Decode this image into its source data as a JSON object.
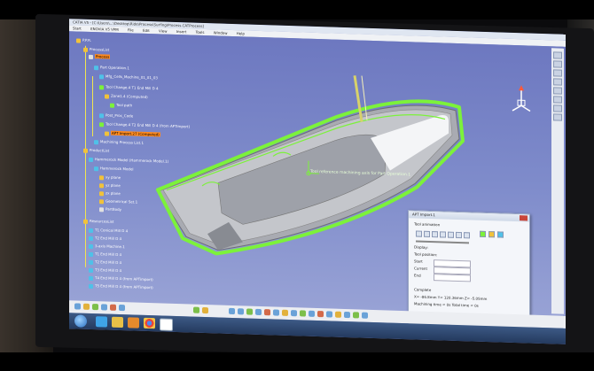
{
  "window": {
    "title": "CATIA V5 - [C:\\Users\\...\\Desktop\\Ride\\Process\\Surfing\\Process.CATProcess]"
  },
  "menubar": {
    "items": [
      "Start",
      "ENOVIA V5 VPM",
      "File",
      "Edit",
      "View",
      "Insert",
      "Tools",
      "Window",
      "Help"
    ]
  },
  "tree": {
    "items": [
      {
        "label": "P.P.R."
      },
      {
        "label": "ProcessList"
      },
      {
        "label": "Process"
      },
      {
        "label": "Part Operation.1"
      },
      {
        "label": "Mfg_Cells_Machine_01_01_03"
      },
      {
        "label": "Tool Change.4  T1 End Mill D 4"
      },
      {
        "label": "Zone1.4 (Computed)"
      },
      {
        "label": "Tool path"
      },
      {
        "label": "Post_Proc_Code"
      },
      {
        "label": "Tool Change.4  T2 End Mill D 4 (from APTimport)"
      },
      {
        "label": "APT Import.27 (Computed)"
      },
      {
        "label": "Machining Process List.1"
      },
      {
        "label": "ProductList"
      },
      {
        "label": "Hammerock Model (Hammerock Model.1)"
      },
      {
        "label": "Hammerock Model"
      },
      {
        "label": "xy plane"
      },
      {
        "label": "yz plane"
      },
      {
        "label": "zx plane"
      },
      {
        "label": "Geometrical Set.1"
      },
      {
        "label": "PartBody"
      },
      {
        "label": "ResourcesList"
      },
      {
        "label": "T1 Conical Mill D 4"
      },
      {
        "label": "T2 End Mill D 4"
      },
      {
        "label": "3-axis Machine.1"
      },
      {
        "label": "T1 End Mill D 4"
      },
      {
        "label": "T2 End Mill D 4"
      },
      {
        "label": "T3 End Mill D 4"
      },
      {
        "label": "T4 End Mill D 4 (from APTimport)"
      },
      {
        "label": "T5 End Mill D 4 (from APTimport)"
      }
    ]
  },
  "viewport": {
    "annotation": "Tool reference machining axis for Part Operation.1"
  },
  "dialog": {
    "title": "APT Import.1",
    "group_label": "Tool animation",
    "display_label": "Display:",
    "tool_position_label": "Tool position:",
    "fields": [
      "Start",
      "Current",
      "End"
    ],
    "footer_title": "Complete",
    "footer_lines": [
      "X= -86.8mm  Y= 120.36mm  Z= -5.05mm",
      "Machining time = 0s  Total time = 0s"
    ]
  },
  "colors": {
    "toolpath_green": "#7cf23a",
    "part_grey": "#b5b7bc",
    "background_blue": "#7b88c8",
    "highlight_orange": "#ff8a1f"
  },
  "icons": [
    "start-orb-icon",
    "ie-icon",
    "explorer-icon",
    "media-player-icon",
    "chrome-icon",
    "catia-icon"
  ]
}
